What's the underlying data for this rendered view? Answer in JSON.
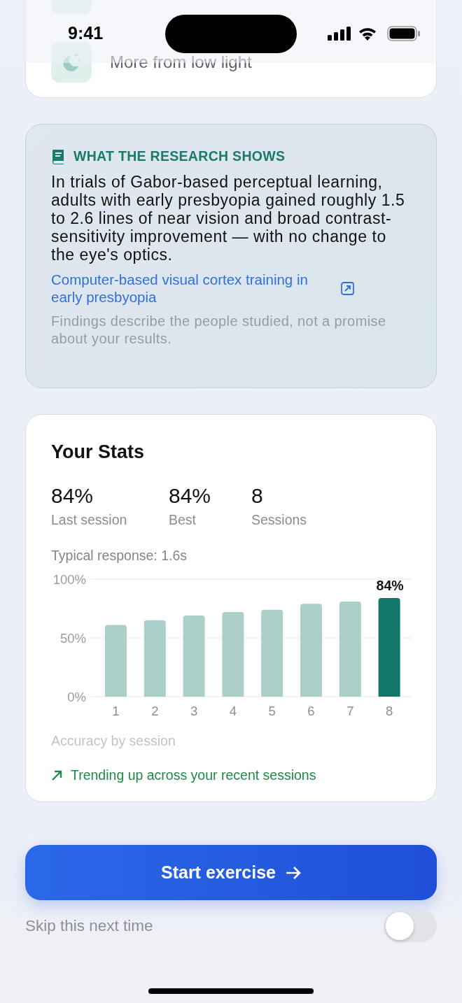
{
  "status_bar": {
    "time": "9:41"
  },
  "top_list": {
    "items": [
      {
        "label": "More from low light"
      }
    ]
  },
  "research": {
    "heading": "WHAT THE RESEARCH SHOWS",
    "body": "In trials of Gabor-based perceptual learning, adults with early presbyopia gained roughly 1.5 to 2.6 lines of near vision and broad contrast-sensitivity improvement — with no change to the eye's optics.",
    "link": "Computer-based visual cortex training in early presbyopia",
    "note": "Findings describe the people studied, not a promise about your results."
  },
  "stats": {
    "title": "Your Stats",
    "metrics": [
      {
        "value": "84%",
        "label": "Last session"
      },
      {
        "value": "84%",
        "label": "Best"
      },
      {
        "value": "8",
        "label": "Sessions"
      }
    ],
    "typical_response": "Typical response: 1.6s",
    "chart_data": {
      "type": "bar",
      "xlabel": "Accuracy by session",
      "categories": [
        "1",
        "2",
        "3",
        "4",
        "5",
        "6",
        "7",
        "8"
      ],
      "series": [
        {
          "color": "#abd0ca",
          "values": [
            61,
            65,
            69,
            72,
            74,
            79,
            81,
            null
          ]
        },
        {
          "color": "#12766b",
          "values": [
            null,
            null,
            null,
            null,
            null,
            null,
            null,
            84
          ]
        }
      ],
      "stacked": true,
      "ylim": [
        0,
        100
      ],
      "yticks": [
        {
          "value": 0,
          "label": "0%"
        },
        {
          "value": 50,
          "label": "50%"
        },
        {
          "value": 100,
          "label": "100%"
        }
      ],
      "annotations": [
        "84%"
      ]
    },
    "trend": "Trending up across your recent sessions"
  },
  "start_button": {
    "label": "Start exercise"
  },
  "skip": {
    "label": "Skip this next time",
    "on": false
  }
}
